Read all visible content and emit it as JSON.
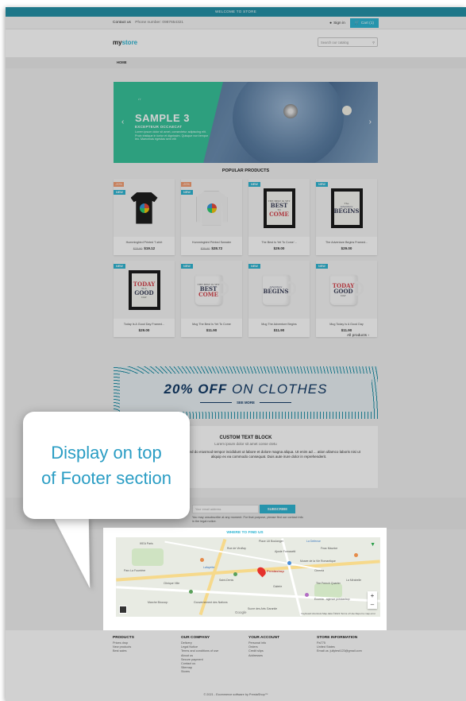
{
  "topbar": {
    "text": "WELCOME TO STORE"
  },
  "nav": {
    "contact": "Contact us",
    "phone": "Phone number: 0987654321",
    "signin": "Sign in",
    "cart": "Cart (1)"
  },
  "header": {
    "logo_main": "my",
    "logo_accent": "store",
    "search_placeholder": "Search our catalog"
  },
  "breadcrumb": {
    "home": "HOME"
  },
  "slider": {
    "title": "SAMPLE 3",
    "subtitle": "EXCEPTEUR OCCAECAT",
    "description": "Lorem ipsum dolor sit amet, consectetur adipiscing elit. Proin tristique in tortor et dignissim. Quisque non tempor leo. Maecenas egestas sem elit",
    "quote_mark": "“",
    "prev_arrow": "‹",
    "next_arrow": "›"
  },
  "popular": {
    "title": "POPULAR PRODUCTS",
    "products": [
      {
        "name": "Hummingbird Printed T-shirt",
        "old_price": "$23.90",
        "price": "$19.12",
        "discount": "-20%",
        "badge": "NEW"
      },
      {
        "name": "Hummingbird Printed Sweater",
        "old_price": "$35.90",
        "price": "$28.72",
        "discount": "-20%",
        "badge": "NEW"
      },
      {
        "name": "The Best Is Yet To Come'...",
        "price": "$29.00",
        "badge": "NEW"
      },
      {
        "name": "The Adventure Begins Framed...",
        "price": "$29.00",
        "badge": "NEW"
      },
      {
        "name": "Today Is A Good Day Framed...",
        "price": "$29.00",
        "badge": "NEW"
      },
      {
        "name": "Mug The Best Is Yet To Come",
        "price": "$11.90",
        "badge": "NEW"
      },
      {
        "name": "Mug The Adventure Begins",
        "price": "$11.90",
        "badge": "NEW"
      },
      {
        "name": "Mug Today Is A Good Day",
        "price": "$11.90",
        "badge": "NEW"
      }
    ],
    "all_products": "All products ›"
  },
  "posters": {
    "best_small": "THE BEST IS YET",
    "best_big": "BEST",
    "best_to": "TO",
    "best_come": "COME",
    "adventure_small": "The",
    "adventure_mid": "Adventure",
    "adventure_big": "BEGINS",
    "today_big": "TODAY",
    "today_small": "IS A",
    "today_good": "GOOD",
    "today_day": "DAY"
  },
  "promo": {
    "bold": "20% OFF",
    "rest": " ON CLOTHES",
    "see_more": "SEE MORE"
  },
  "custom_block": {
    "title": "CUSTOM TEXT BLOCK",
    "subtitle": "Lorem ipsum dolor sit amet conse ctetu",
    "body": "... elit, sed do eiusmod tempor incididunt ut labore et dolore magna aliqua. Ut enim ad ... ation ullamco laboris nisi ut aliquip ex ea commodo consequat. Duis aute irure dolor in reprehenderit."
  },
  "newsletter": {
    "placeholder": "Your email address",
    "button": "SUBSCRIBE",
    "note": "You may unsubscribe at any moment. For that purpose, please find our contact info in the legal notice."
  },
  "map": {
    "title": "WHERE TO FIND US",
    "marker_label": "Prestashop",
    "google": "Google",
    "footer_note": "Keyboard shortcuts   Map data ©2021   Terms of Use   Report a map error",
    "labels": [
      "Place Lili Boulanger",
      "La Defense",
      "Rue de Viroflay",
      "Fnac Maurice",
      "Musee de la Vie Romantique",
      "Ajuste Fornasetti",
      "Lafayette",
      "Cinema",
      "The French Quarter",
      "La Mirabelle",
      "Ecomia - agence prestashop",
      "Gouvernement des Nations",
      "Sucre des Arts Garantie",
      "IKEA Paris",
      "Clinique Ville",
      "Parc La Fourrière",
      "Saint-Denis",
      "Galerie",
      "Marche Biocoop"
    ]
  },
  "callout": {
    "line1": "Display on top",
    "line2": "of Footer section"
  },
  "footer": {
    "products": {
      "title": "PRODUCTS",
      "items": [
        "Prices drop",
        "New products",
        "Best sales"
      ]
    },
    "company": {
      "title": "OUR COMPANY",
      "items": [
        "Delivery",
        "Legal Notice",
        "Terms and conditions of use",
        "About us",
        "Secure payment",
        "Contact us",
        "Sitemap",
        "Stores"
      ]
    },
    "account": {
      "title": "YOUR ACCOUNT",
      "items": [
        "Personal info",
        "Orders",
        "Credit slips",
        "Addresses"
      ]
    },
    "store": {
      "title": "STORE INFORMATION",
      "items": [
        "Pa775",
        "United States",
        "Email us: jullytest123@gmail.com"
      ]
    },
    "copyright": "© 2021 - Ecommerce software by PrestaShop™"
  },
  "colors": {
    "accent": "#2fb5d2",
    "topbar": "#2592a8",
    "slider_panel": "#37c39a",
    "callout_text": "#2a9dc4"
  }
}
